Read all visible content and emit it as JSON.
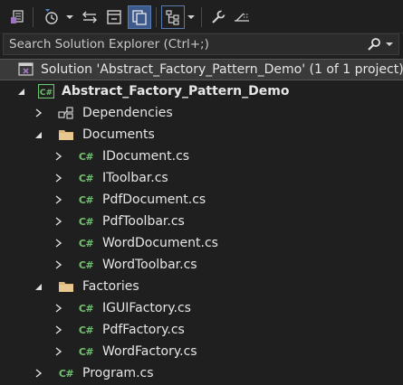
{
  "toolbar": {
    "icons": [
      "switch-views-icon",
      "history-icon",
      "dropdown-arrow-icon",
      "sync-icon",
      "collapse-all-icon",
      "show-all-files-icon",
      "dropdown-arrow-icon",
      "scope-icon",
      "dropdown-arrow-icon",
      "properties-wrench-icon",
      "preview-selected-icon"
    ]
  },
  "search": {
    "placeholder": "Search Solution Explorer (Ctrl+;)",
    "icon": "search-icon"
  },
  "tree": {
    "solution": "Solution 'Abstract_Factory_Pattern_Demo' (1 of 1 project)",
    "project": "Abstract_Factory_Pattern_Demo",
    "items": [
      {
        "label": "Dependencies",
        "icon": "dependencies-icon"
      },
      {
        "label": "Documents",
        "icon": "folder-icon"
      },
      {
        "label": "IDocument.cs",
        "icon": "csharp-file-icon"
      },
      {
        "label": "IToolbar.cs",
        "icon": "csharp-file-icon"
      },
      {
        "label": "PdfDocument.cs",
        "icon": "csharp-file-icon"
      },
      {
        "label": "PdfToolbar.cs",
        "icon": "csharp-file-icon"
      },
      {
        "label": "WordDocument.cs",
        "icon": "csharp-file-icon"
      },
      {
        "label": "WordToolbar.cs",
        "icon": "csharp-file-icon"
      },
      {
        "label": "Factories",
        "icon": "folder-icon"
      },
      {
        "label": "IGUIFactory.cs",
        "icon": "csharp-file-icon"
      },
      {
        "label": "PdfFactory.cs",
        "icon": "csharp-file-icon"
      },
      {
        "label": "WordFactory.cs",
        "icon": "csharp-file-icon"
      },
      {
        "label": "Program.cs",
        "icon": "csharp-file-icon"
      }
    ],
    "csharp_badge": "C#"
  },
  "colors": {
    "background": "#1f1f1f",
    "selected_row": "#3a3a3a",
    "csharp_green": "#6fc36f",
    "folder": "#dcb67a",
    "accent_purple": "#a074c4",
    "active_blue": "#3c5a8c"
  }
}
